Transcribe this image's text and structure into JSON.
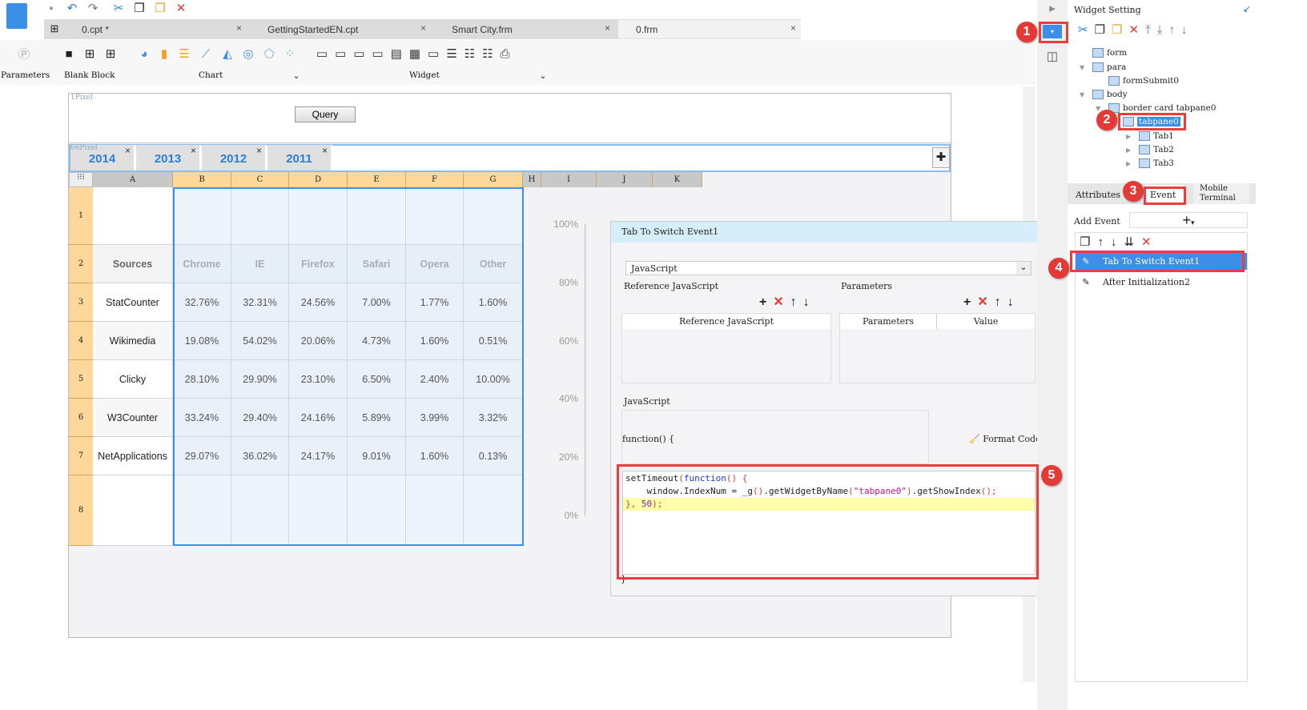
{
  "toolbar": {
    "icons": [
      "save-icon",
      "undo-icon",
      "redo-icon",
      "cut-icon",
      "copy-icon",
      "paste-icon",
      "delete-icon"
    ]
  },
  "tabs": [
    {
      "label": "0.cpt *"
    },
    {
      "label": "GettingStartedEN.cpt"
    },
    {
      "label": "Smart City.frm"
    },
    {
      "label": "0.frm"
    }
  ],
  "ribbon": {
    "parameters": "Parameters",
    "blank_block": "Blank Block",
    "chart": "Chart",
    "widget": "Widget"
  },
  "form": {
    "param_pixel": "1Pixel",
    "query": "Query",
    "tab_pixel": "66Pixel",
    "year_tabs": [
      "2014",
      "2013",
      "2012",
      "2011"
    ]
  },
  "grid": {
    "columns": [
      "A",
      "B",
      "C",
      "D",
      "E",
      "F",
      "G",
      "H",
      "I",
      "J",
      "K"
    ],
    "rows": [
      "1",
      "2",
      "3",
      "4",
      "5",
      "6",
      "7",
      "8"
    ],
    "header": [
      "Sources",
      "Chrome",
      "IE",
      "Firefox",
      "Safari",
      "Opera",
      "Other"
    ],
    "data": [
      [
        "StatCounter",
        "32.76%",
        "32.31%",
        "24.56%",
        "7.00%",
        "1.77%",
        "1.60%"
      ],
      [
        "Wikimedia",
        "19.08%",
        "54.02%",
        "20.06%",
        "4.73%",
        "1.60%",
        "0.51%"
      ],
      [
        "Clicky",
        "28.10%",
        "29.90%",
        "23.10%",
        "6.50%",
        "2.40%",
        "10.00%"
      ],
      [
        "W3Counter",
        "33.24%",
        "29.40%",
        "24.16%",
        "5.89%",
        "3.99%",
        "3.32%"
      ],
      [
        "NetApplications",
        "29.07%",
        "36.02%",
        "24.17%",
        "9.01%",
        "1.60%",
        "0.13%"
      ]
    ]
  },
  "chart_axis": [
    "100%",
    "80%",
    "60%",
    "40%",
    "20%",
    "0%"
  ],
  "dialog": {
    "title": "Tab To Switch Event1",
    "type": "JavaScript",
    "ref_js_label": "Reference JavaScript",
    "params_label": "Parameters",
    "ref_js_col": "Reference JavaScript",
    "params_col": "Parameters",
    "value_col": "Value",
    "js_label": "JavaScript",
    "function_sig": "function() {",
    "format_code": "Format Code",
    "closing": "}",
    "code": {
      "l1a": "setTimeout",
      "l1b": "(",
      "l1c": "function",
      "l1d": "() {",
      "l2a": "    window.IndexNum = _g",
      "l2b": "()",
      ".": "",
      "l2c": ".getWidgetByName",
      "l2d": "(",
      "l2e": "\"tabpane0\"",
      "l2f": ")",
      "l2g": ".getShowIndex",
      "l2h": "();",
      "l3a": "}, ",
      "l3b": "50",
      "l3c": ");"
    }
  },
  "panel": {
    "title": "Widget Setting",
    "tree": [
      "form",
      "para",
      "formSubmit0",
      "body",
      "border card tabpane0",
      "tabpane0",
      "Tab1",
      "Tab2",
      "Tab3"
    ],
    "tabs": [
      "Attributes",
      "Event",
      "Mobile Terminal"
    ],
    "add_event": "Add Event",
    "events": [
      "Tab To Switch Event1",
      "After Initialization2"
    ]
  },
  "badges": [
    "1",
    "2",
    "3",
    "4",
    "5"
  ],
  "colors": {
    "accent": "#3c8ee8",
    "highlight": "#ef3b3b",
    "header_cell": "#fdd89a",
    "dialog_header": "#d6eefa"
  }
}
